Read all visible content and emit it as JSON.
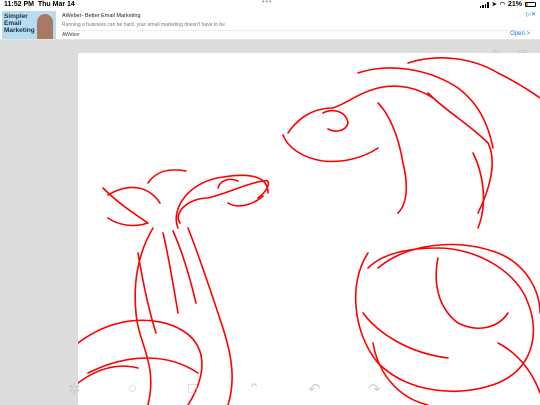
{
  "status_bar": {
    "time": "11:52 PM",
    "date": "Thu Mar 14",
    "battery_percent": "21%",
    "battery_level": 0.21
  },
  "ad": {
    "image_text": [
      "Simpler",
      "Email",
      "Marketing"
    ],
    "title": "AWeber- Better Email Marketing",
    "description": "Running a business can be hard, your email marketing doesn't have to be",
    "brand": "AWeber",
    "cta": "Open",
    "cta_arrow": ">",
    "adchoices_icon": "play-triangle-icon"
  },
  "colors": {
    "sketch_stroke": "#ff0000",
    "canvas_bg": "#ffffff",
    "app_bg": "#dcdcdc",
    "link_blue": "#1a73e8"
  },
  "toolbar": {
    "icons": [
      "layers-icon",
      "brush-icon",
      "mail-icon"
    ]
  },
  "bottom_bar": {
    "icons": [
      "settings-icon",
      "brush-size-icon",
      "color-square-icon",
      "arrow-icon",
      "undo-icon",
      "redo-icon"
    ]
  }
}
